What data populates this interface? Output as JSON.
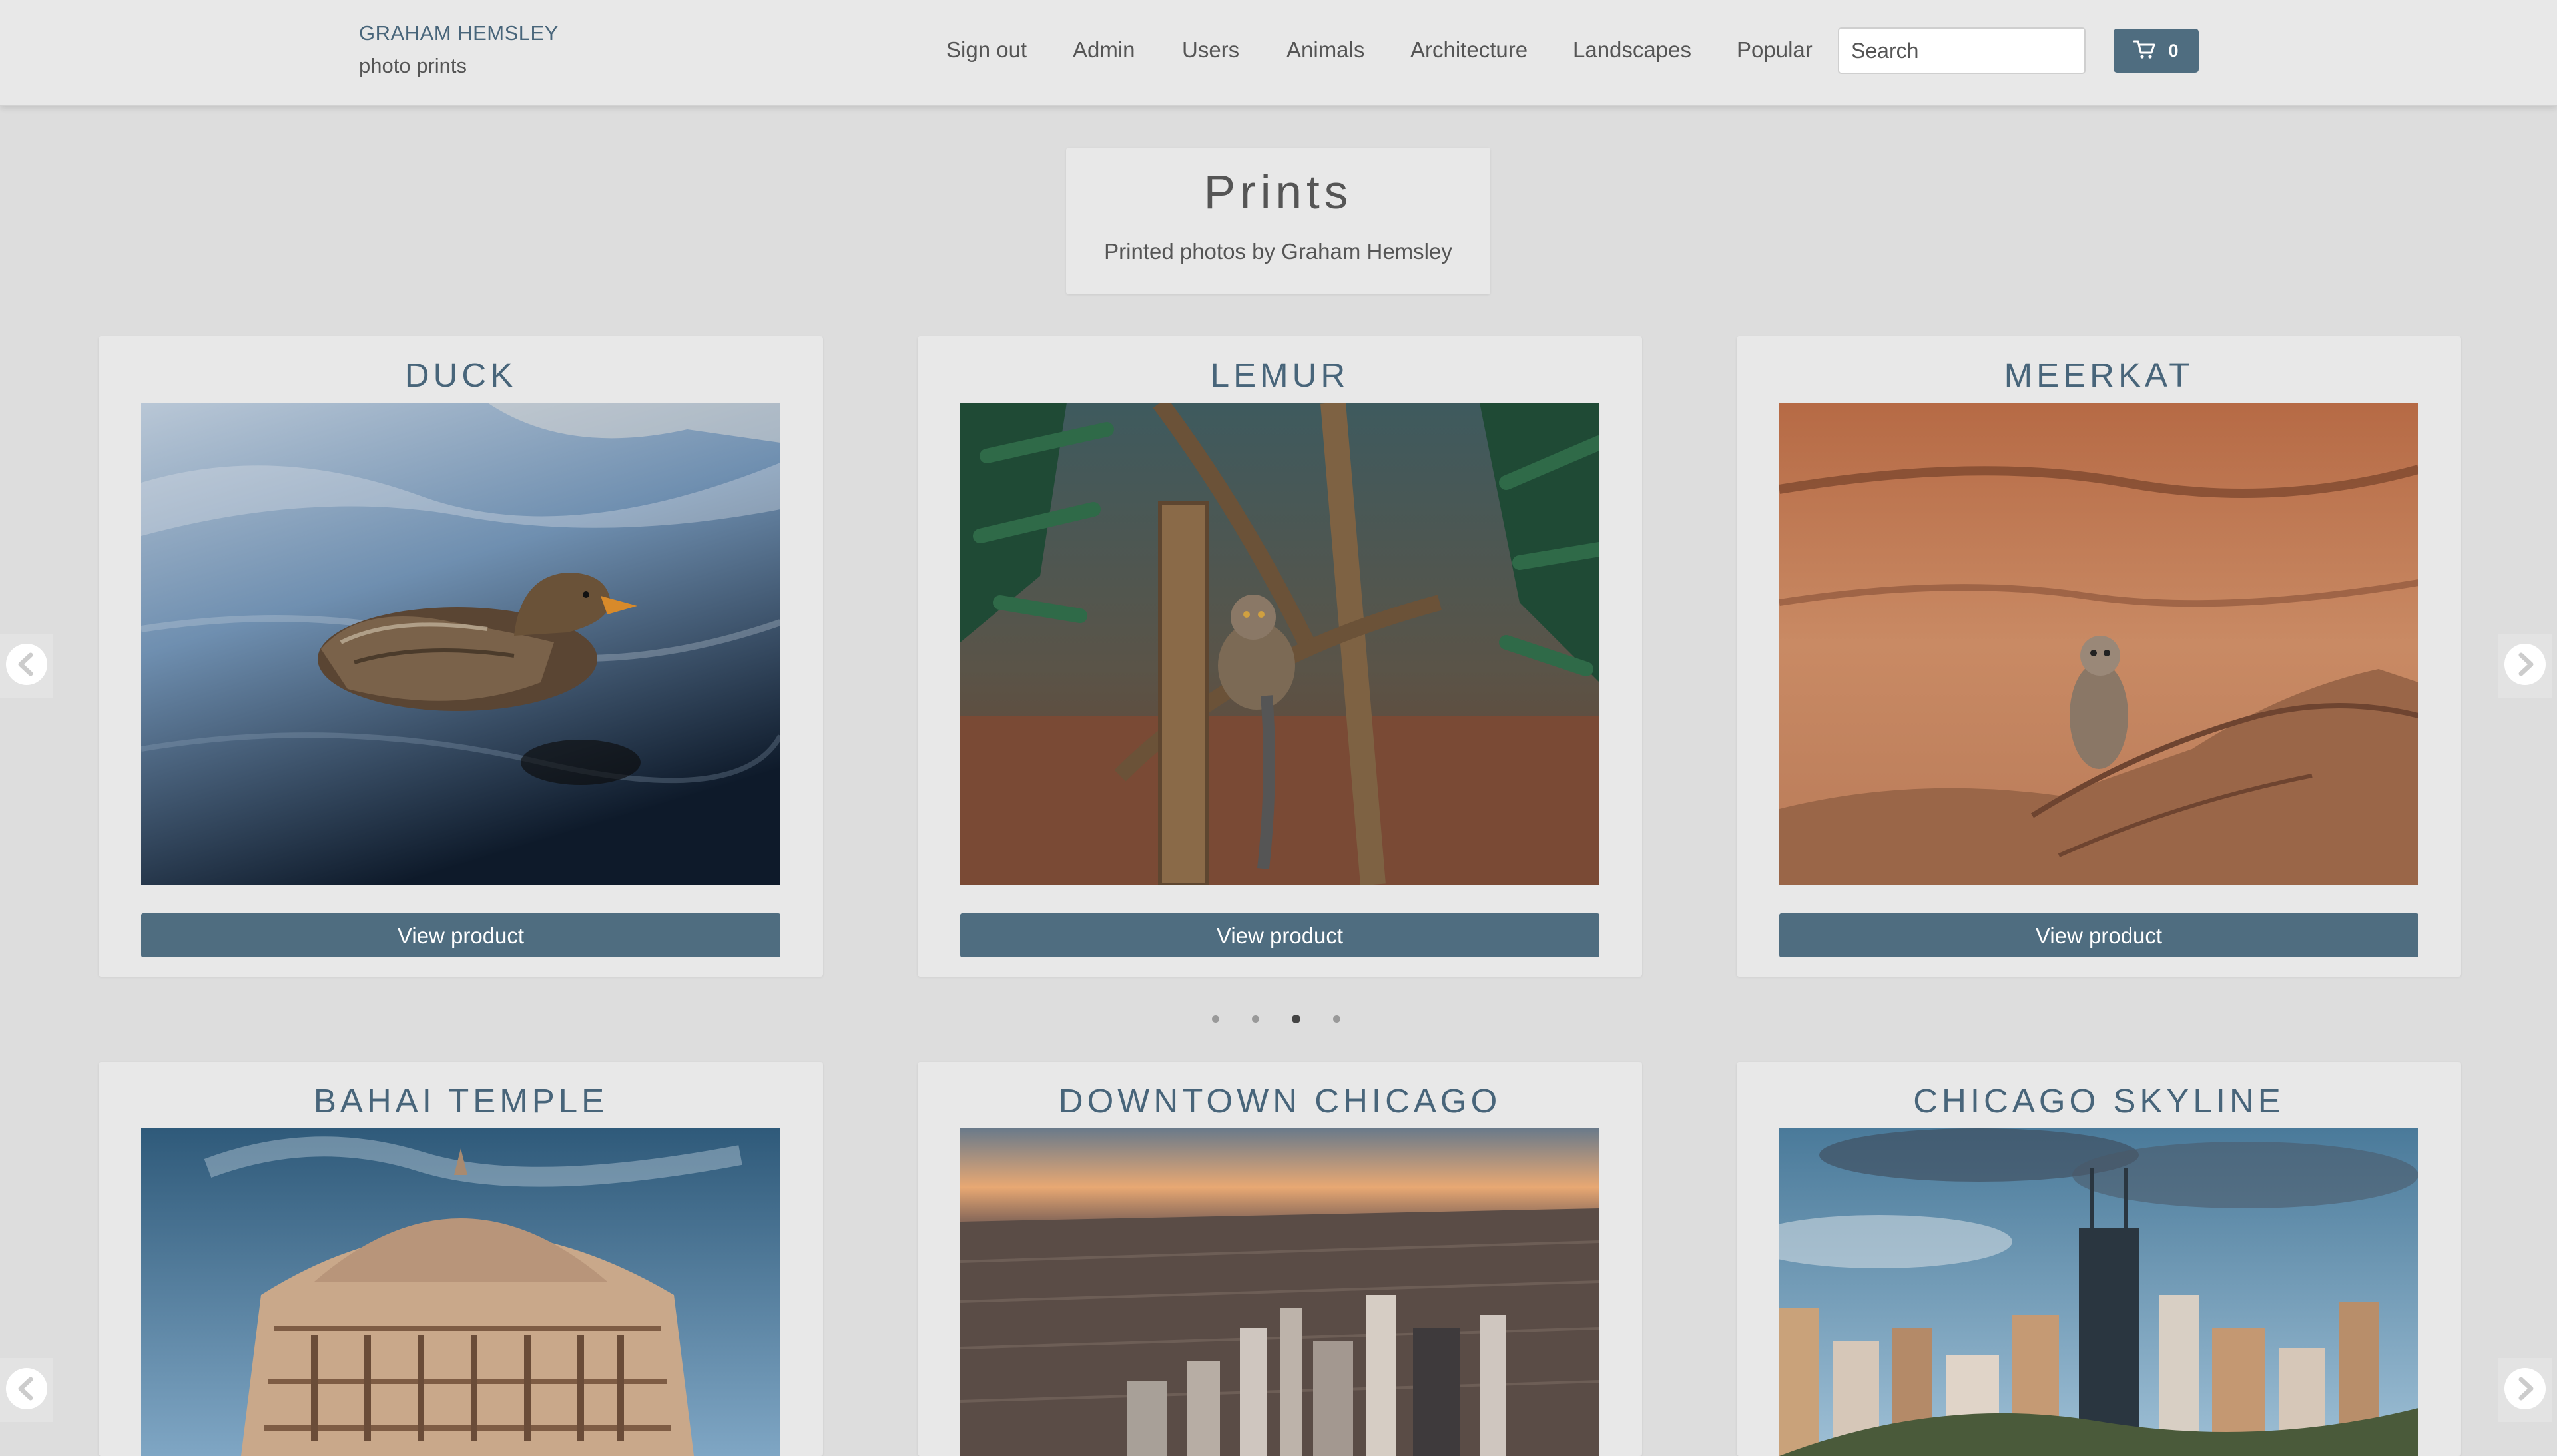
{
  "brand": {
    "name": "GRAHAM HEMSLEY",
    "sub": "photo prints"
  },
  "nav": {
    "links": [
      "Sign out",
      "Admin",
      "Users",
      "Animals",
      "Architecture",
      "Landscapes",
      "Popular"
    ],
    "search_placeholder": "Search",
    "cart_icon": "cart-icon",
    "cart_count": "0"
  },
  "header": {
    "title": "Prints",
    "subtitle": "Printed photos by Graham Hemsley"
  },
  "carousels": [
    {
      "products": [
        {
          "title": "DUCK",
          "button": "View product"
        },
        {
          "title": "LEMUR",
          "button": "View product"
        },
        {
          "title": "MEERKAT",
          "button": "View product"
        }
      ],
      "dots": 4,
      "active_dot": 3
    },
    {
      "products": [
        {
          "title": "BAHAI TEMPLE"
        },
        {
          "title": "DOWNTOWN CHICAGO"
        },
        {
          "title": "CHICAGO SKYLINE"
        }
      ]
    }
  ],
  "colors": {
    "accent": "#4f6d80",
    "title_blue": "#48657a",
    "background": "#dddddd",
    "card": "#e8e8e8"
  },
  "icons": {
    "prev": "chevron-left-icon",
    "next": "chevron-right-icon"
  }
}
